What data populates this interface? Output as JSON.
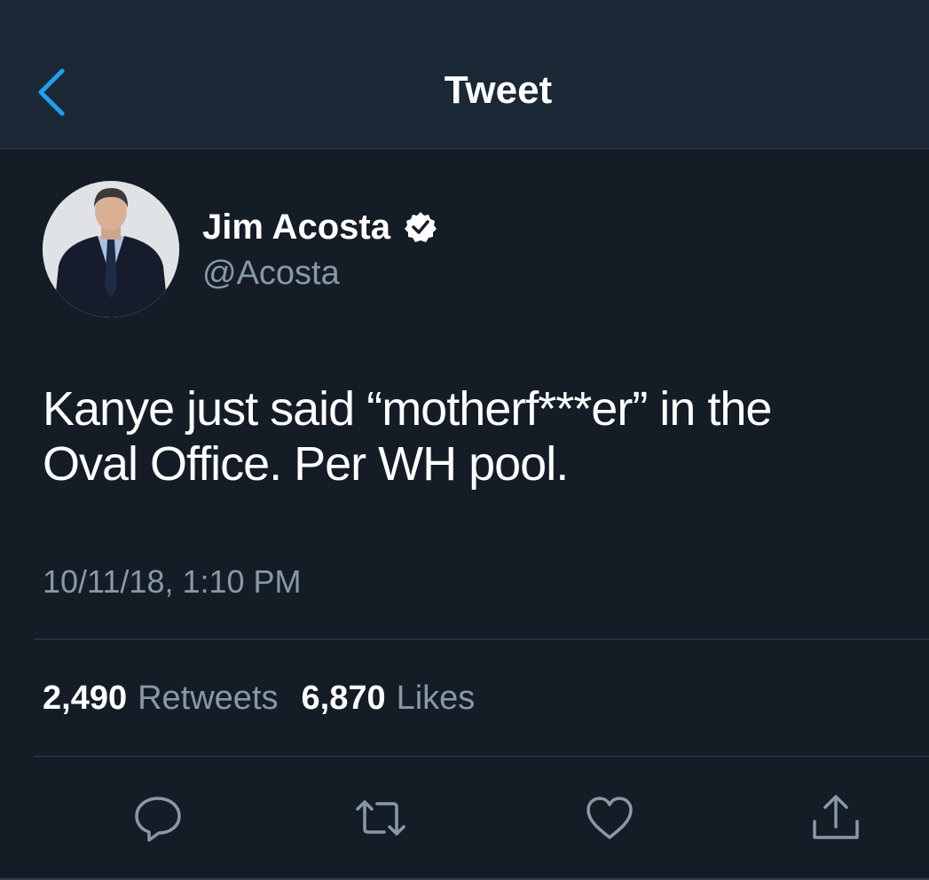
{
  "nav": {
    "title": "Tweet",
    "back_icon": "chevron-left-icon"
  },
  "author": {
    "name": "Jim Acosta",
    "handle": "@Acosta",
    "verified": true
  },
  "tweet": {
    "text_line1": "Kanye just said “motherf***er” in the",
    "text_line2": "Oval Office. Per WH pool.",
    "timestamp": "10/11/18, 1:10 PM"
  },
  "stats": {
    "retweets_count": "2,490",
    "retweets_label": "Retweets",
    "likes_count": "6,870",
    "likes_label": "Likes"
  },
  "actions": {
    "reply_icon": "reply-icon",
    "retweet_icon": "retweet-icon",
    "like_icon": "heart-icon",
    "share_icon": "share-icon"
  },
  "colors": {
    "background": "#141d26",
    "nav_background": "#1b2836",
    "accent": "#1da1f2",
    "secondary_text": "#8899a6",
    "divider": "#2f3d4c"
  }
}
